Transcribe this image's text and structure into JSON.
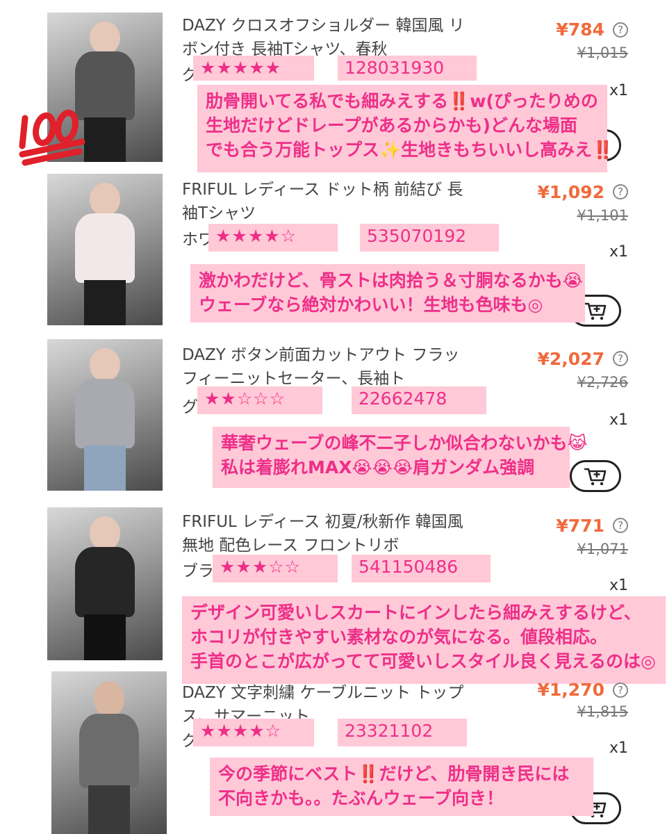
{
  "items": [
    {
      "title": "DAZY クロスオフショルダー 韓国風 リボン付き 長袖Tシャツ、春秋",
      "variant": "グ",
      "price": "¥784",
      "original_price": "¥1,015",
      "quantity": "x1",
      "rating": "★★★★★",
      "product_code": "128031930",
      "comment": [
        "肋骨開いてる私でも細みえする‼️w(ぴったりめの",
        "生地だけどドレープがあるからかも)どんな場面",
        "でも合う万能トップス✨生地きもちいいし高みえ‼️"
      ]
    },
    {
      "title": "FRIFUL レディース ドット柄 前結び 長袖Tシャツ",
      "variant": "ホワ",
      "price": "¥1,092",
      "original_price": "¥1,101",
      "quantity": "x1",
      "rating": "★★★★☆",
      "product_code": "535070192",
      "comment": [
        "激かわだけど、骨ストは肉拾う＆寸胴なるかも😭",
        "ウェーブなら絶対かわいい！生地も色味も◎"
      ]
    },
    {
      "title": "DAZY ボタン前面カットアウト フラッフィーニットセーター、長袖ト",
      "variant": "グ",
      "price": "¥2,027",
      "original_price": "¥2,726",
      "quantity": "x1",
      "rating": "★★☆☆☆",
      "product_code": "22662478",
      "comment": [
        "華奢ウェーブの峰不二子しか似合わないかも😹",
        "私は着膨れMAX😭😭😭肩ガンダム強調"
      ]
    },
    {
      "title": "FRIFUL レディース 初夏/秋新作 韓国風 無地 配色レース フロントリボ",
      "variant": "ブラ",
      "price": "¥771",
      "original_price": "¥1,071",
      "quantity": "x1",
      "rating": "★★★☆☆",
      "product_code": "541150486",
      "comment": [
        "デザイン可愛いしスカートにインしたら細みえするけど、",
        "ホコリが付きやすい素材なのが気になる。値段相応。",
        "手首のとこが広がってて可愛いしスタイル良く見えるのは◎"
      ]
    },
    {
      "title": "DAZY 文字刺繍 ケーブルニット トップス、サマーニット",
      "variant": "グ",
      "price": "¥1,270",
      "original_price": "¥1,815",
      "quantity": "x1",
      "rating": "★★★★☆",
      "product_code": "23321102",
      "comment": [
        "今の季節にベスト‼️だけど、肋骨開き民には",
        "不向きかも。。たぶんウェーブ向き！"
      ]
    }
  ],
  "colors": {
    "price": "#f06a3c",
    "highlight_bg": "#ffc9d8",
    "highlight_text": "#ee2f88"
  },
  "icons": {
    "sticker": "hundred-points-icon",
    "cart": "add-to-cart-icon",
    "info": "question-circle-icon"
  }
}
